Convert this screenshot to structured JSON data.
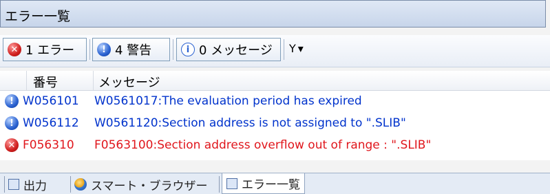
{
  "window": {
    "title": "エラー一覧"
  },
  "toolbar": {
    "errors_label": "1 エラー",
    "warnings_label": "4 警告",
    "messages_label": "0 メッセージ",
    "filter_glyph": "Y",
    "dropdown_glyph": "▾"
  },
  "table": {
    "headers": {
      "number": "番号",
      "message": "メッセージ"
    },
    "rows": [
      {
        "type": "warning",
        "code": "W056101",
        "message": "W0561017:The evaluation period has expired"
      },
      {
        "type": "warning",
        "code": "W056112",
        "message": "W0561120:Section address is not assigned to \".SLIB\""
      },
      {
        "type": "error",
        "code": "F056310",
        "message": "F0563100:Section address overflow out of range : \".SLIB\""
      }
    ]
  },
  "tabs": [
    {
      "label": "出力",
      "icon": "output-icon"
    },
    {
      "label": "スマート・ブラウザー",
      "icon": "smart-browser-icon"
    },
    {
      "label": "エラー一覧",
      "icon": "error-list-icon",
      "active": true
    }
  ],
  "colors": {
    "error": "#e0161c",
    "warning": "#0033cc"
  }
}
